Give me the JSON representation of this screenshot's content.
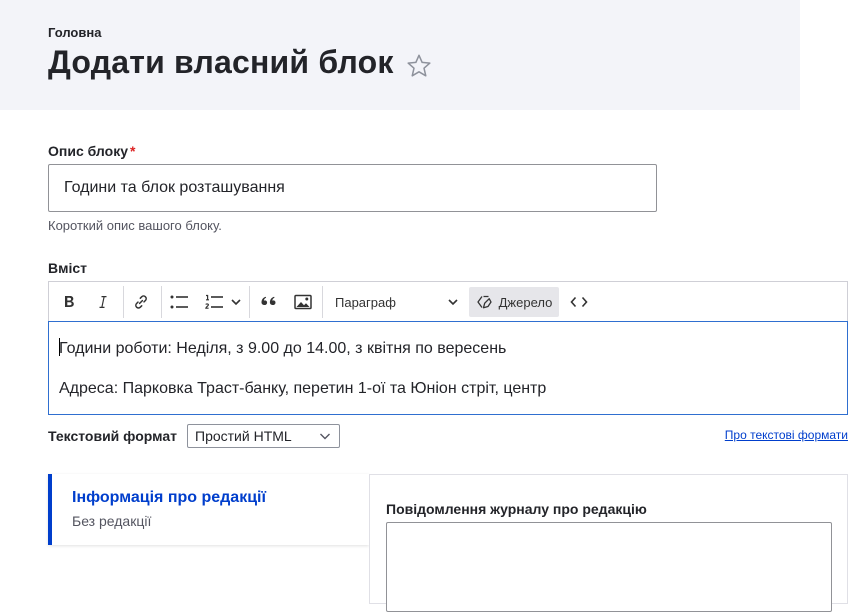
{
  "header": {
    "breadcrumb": "Головна",
    "title": "Додати власний блок",
    "favorite_icon": "star-outline-icon"
  },
  "form": {
    "block_description": {
      "label": "Опис блоку",
      "required_marker": "*",
      "value": "Години та блок розташування",
      "help": "Короткий опис вашого блоку."
    },
    "body": {
      "label": "Вміст",
      "toolbar": {
        "bold_icon": "bold-icon",
        "italic_icon": "italic-icon",
        "link_icon": "link-icon",
        "bullet_list_icon": "bulleted-list-icon",
        "numbered_list_icon": "numbered-list-icon",
        "blockquote_icon": "blockquote-icon",
        "image_icon": "image-icon",
        "heading_select": "Параграф",
        "source_label": "Джерело",
        "code_icon": "code-block-icon"
      },
      "paragraphs": [
        "Години роботи: Неділя, з 9.00 до 14.00, з квітня по вересень",
        "Адреса: Парковка Траст-банку, перетин 1-ої та Юніон стріт, центр"
      ]
    },
    "text_format": {
      "label": "Текстовий формат",
      "selected": "Простий HTML",
      "help_link": "Про текстові формати"
    }
  },
  "revision": {
    "tab_title": "Інформація про редакції",
    "tab_summary": "Без редакції",
    "log_label": "Повідомлення журналу про редакцію",
    "log_value": ""
  },
  "colors": {
    "accent": "#003ecc",
    "required": "#dc2323",
    "header_bg": "#f3f4f9",
    "focus_border": "#2f6fd0"
  }
}
